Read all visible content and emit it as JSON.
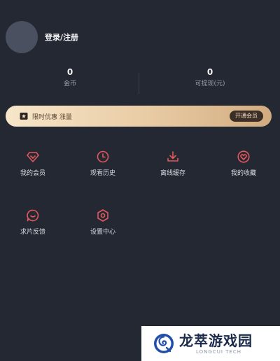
{
  "profile": {
    "login_label": "登录/注册"
  },
  "stats": [
    {
      "value": "0",
      "label": "金币"
    },
    {
      "value": "0",
      "label": "可提现(元)"
    }
  ],
  "vip": {
    "icon": "crown-icon",
    "text": "限时优惠 涨量",
    "button": "开通会员"
  },
  "menu": [
    {
      "label": "我的会员",
      "icon": "diamond-icon"
    },
    {
      "label": "观看历史",
      "icon": "clock-icon"
    },
    {
      "label": "离线缓存",
      "icon": "download-icon"
    },
    {
      "label": "我的收藏",
      "icon": "heart-icon"
    },
    {
      "label": "求片反馈",
      "icon": "chat-smile-icon"
    },
    {
      "label": "设置中心",
      "icon": "gear-icon"
    }
  ],
  "accent_color": "#e2585b",
  "watermark": {
    "title": "龙萃游戏园",
    "subtitle": "LONGCUI TECH"
  }
}
